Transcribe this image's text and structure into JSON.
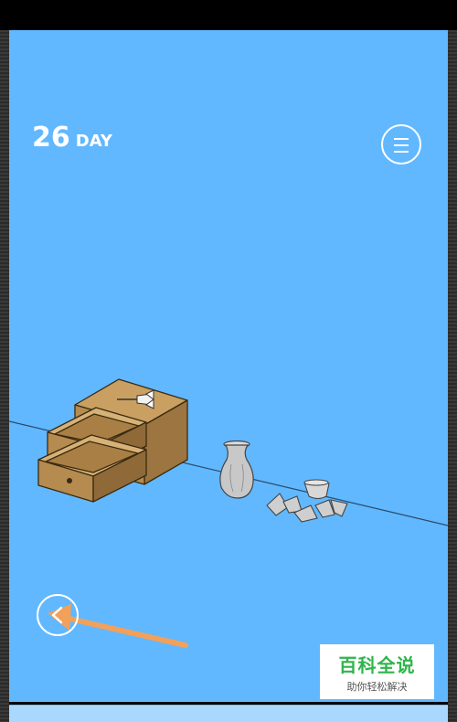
{
  "colors": {
    "background": "#61b8ff",
    "ui_white": "#ffffff",
    "drawer_wood": "#b58b50",
    "arrow_annotation": "#f2a05a",
    "vase": "#c8c8c8",
    "watermark_green": "#2fb54a"
  },
  "hud": {
    "day_number": "26",
    "day_word": "DAY",
    "menu_icon": "hamburger-menu-icon",
    "back_icon": "left-arrow-icon"
  },
  "scene": {
    "objects": [
      "drawer-cabinet",
      "dart",
      "vase",
      "broken-vase-pieces"
    ],
    "cabinet_state": "both drawers open"
  },
  "annotation": {
    "type": "orange arrow pointing to back button"
  },
  "watermark": {
    "title": "百科全说",
    "subtitle": "助你轻松解决"
  }
}
